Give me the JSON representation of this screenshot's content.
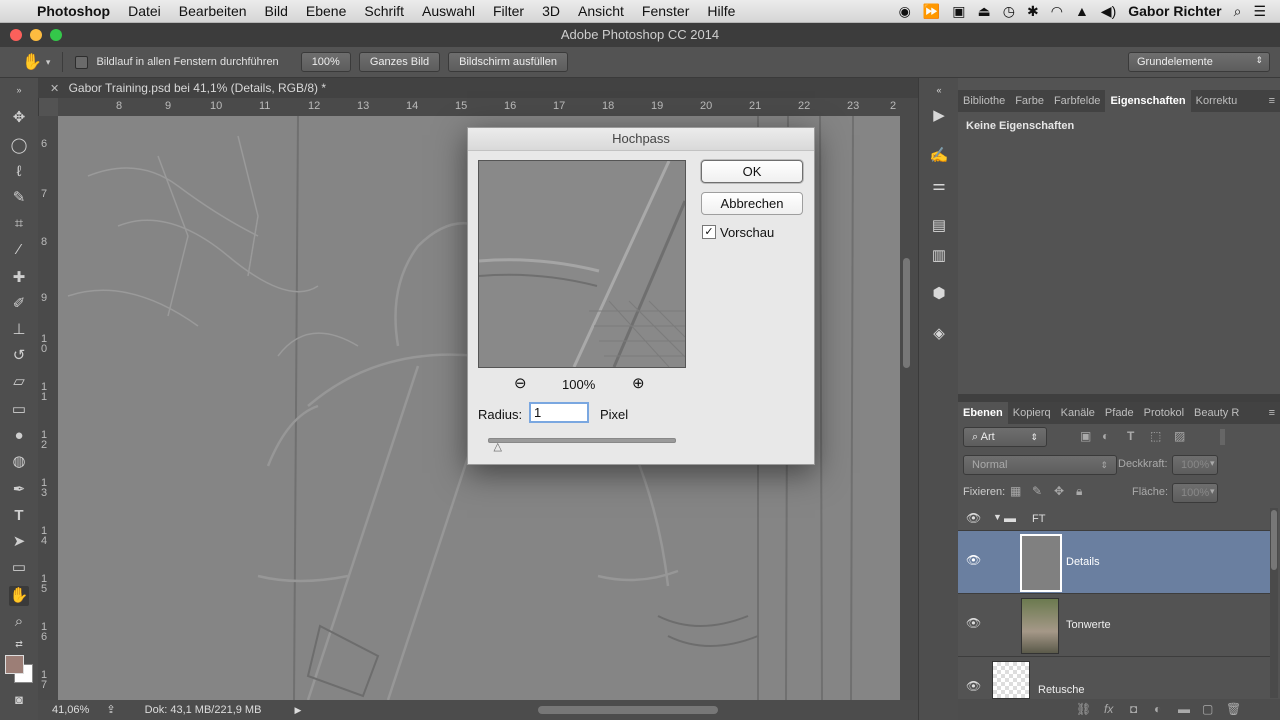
{
  "menubar": {
    "app": "Photoshop",
    "items": [
      "Datei",
      "Bearbeiten",
      "Bild",
      "Ebene",
      "Schrift",
      "Auswahl",
      "Filter",
      "3D",
      "Ansicht",
      "Fenster",
      "Hilfe"
    ],
    "user": "Gabor Richter"
  },
  "window": {
    "title": "Adobe Photoshop CC 2014"
  },
  "options": {
    "scroll_all_label": "Bildlauf in allen Fenstern durchführen",
    "zoom_button": "100%",
    "fit_button": "Ganzes Bild",
    "fill_button": "Bildschirm ausfüllen",
    "workspace": "Grundelemente"
  },
  "document": {
    "tab_title": "Gabor Training.psd bei 41,1% (Details, RGB/8) *",
    "ruler_h": [
      "8",
      "9",
      "10",
      "11",
      "12",
      "13",
      "14",
      "15",
      "16",
      "17",
      "18",
      "19",
      "20",
      "21",
      "22",
      "23",
      "2"
    ],
    "ruler_v": [
      "6",
      "7",
      "8",
      "9",
      "1 0",
      "1 1",
      "1 2",
      "1 3",
      "1 4",
      "1 5",
      "1 6",
      "1 7"
    ]
  },
  "status": {
    "zoom": "41,06%",
    "doc": "Dok: 43,1 MB/221,9 MB"
  },
  "properties_panel": {
    "tabs": [
      "Bibliothe",
      "Farbe",
      "Farbfelde",
      "Eigenschaften",
      "Korrektu"
    ],
    "active_tab": "Eigenschaften",
    "content": "Keine Eigenschaften"
  },
  "layers_panel": {
    "tabs": [
      "Ebenen",
      "Kopierq",
      "Kanäle",
      "Pfade",
      "Protokol",
      "Beauty R"
    ],
    "active_tab": "Ebenen",
    "filter_kind": "Art",
    "blend_mode": "Normal",
    "opacity_label": "Deckkraft:",
    "opacity_value": "100%",
    "lock_label": "Fixieren:",
    "fill_label": "Fläche:",
    "fill_value": "100%",
    "layers": [
      {
        "name": "FT",
        "type": "group"
      },
      {
        "name": "Details",
        "type": "layer",
        "selected": true
      },
      {
        "name": "Tonwerte",
        "type": "layer"
      },
      {
        "name": "Retusche",
        "type": "layer"
      }
    ]
  },
  "dialog": {
    "title": "Hochpass",
    "ok": "OK",
    "cancel": "Abbrechen",
    "preview_label": "Vorschau",
    "preview_checked": true,
    "zoom_value": "100%",
    "radius_label": "Radius:",
    "radius_value": "1",
    "unit": "Pixel",
    "slider_fraction": 0.04
  },
  "colors": {
    "selected_layer": "#6a7fa0",
    "foreground": "#9c7e76",
    "background": "#ffffff"
  }
}
